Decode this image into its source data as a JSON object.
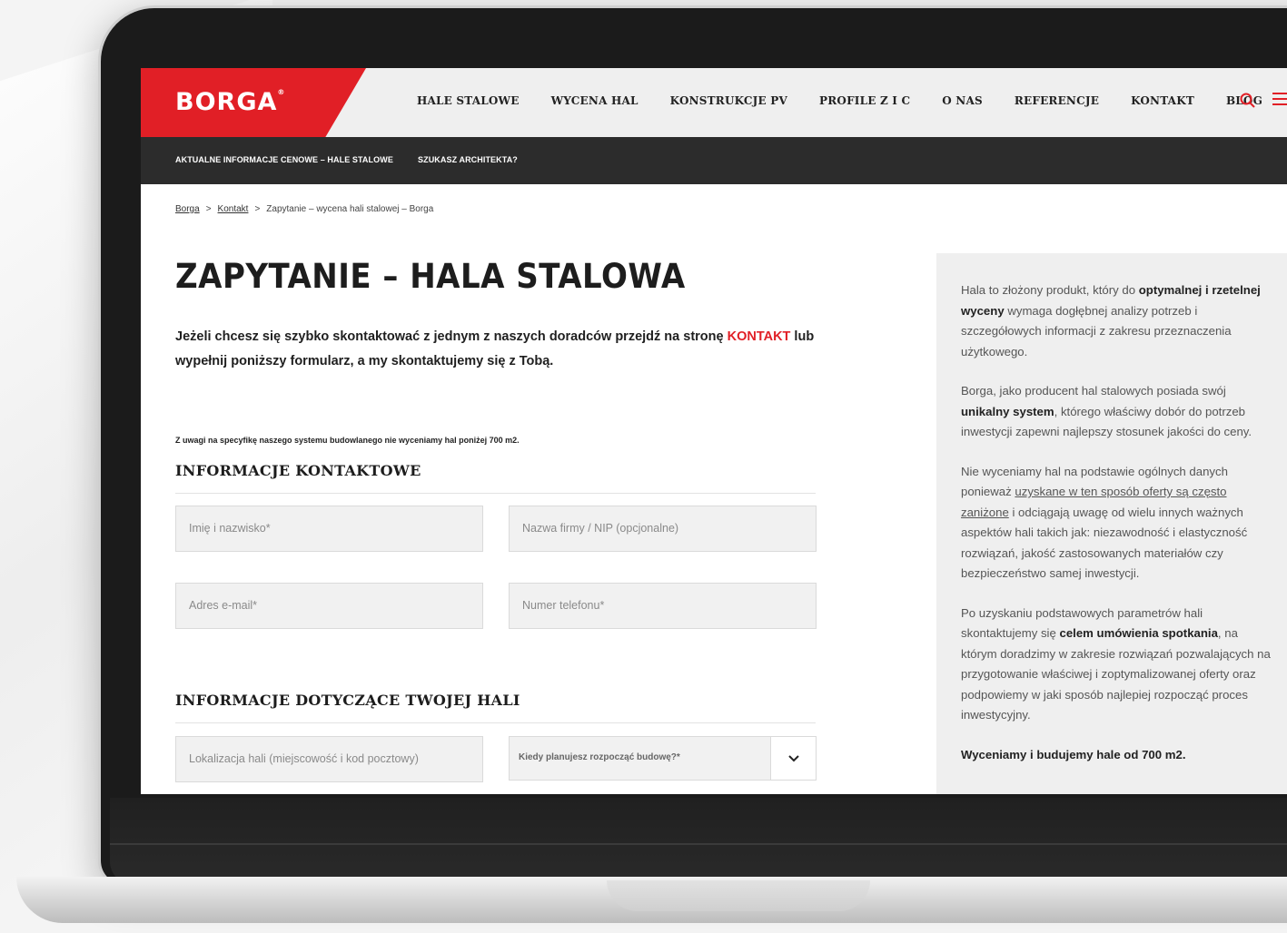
{
  "brand": {
    "logo": "BORGA",
    "registered": "®",
    "accent": "#e11f26"
  },
  "nav": {
    "items": [
      "HALE STALOWE",
      "WYCENA HAL",
      "KONSTRUKCJE PV",
      "PROFILE Z I C",
      "O NAS",
      "REFERENCJE",
      "KONTAKT",
      "BLOG"
    ]
  },
  "subnav": {
    "item1": "AKTUALNE INFORMACJE CENOWE – HALE STALOWE",
    "item2": "SZUKASZ ARCHITEKTA?"
  },
  "breadcrumb": {
    "home": "Borga",
    "sep": ">",
    "contact": "Kontakt",
    "current": "Zapytanie – wycena hali stalowej – Borga"
  },
  "page": {
    "title": "ZAPYTANIE – HALA STALOWA",
    "intro_before": "Jeżeli chcesz się szybko skontaktować z jednym z naszych doradców przejdź na stronę ",
    "intro_link": "KONTAKT",
    "intro_after": " lub wypełnij poniższy formularz, a my skontaktujemy się z Tobą.",
    "note": "Z uwagi na specyfikę naszego systemu budowlanego nie wyceniamy hal poniżej 700 m2."
  },
  "form": {
    "section_contact": "INFORMACJE KONTAKTOWE",
    "name_placeholder": "Imię i nazwisko*",
    "company_placeholder": "Nazwa firmy / NIP (opcjonalne)",
    "email_placeholder": "Adres e-mail*",
    "phone_placeholder": "Numer telefonu*",
    "section_hall": "INFORMACJE DOTYCZĄCE TWOJEJ HALI",
    "location_placeholder": "Lokalizacja hali (miejscowość i kod pocztowy)",
    "start_select": "Kiedy planujesz rozpocząć budowę?*"
  },
  "sidebar": {
    "p1_a": "Hala to złożony produkt, który do ",
    "p1_b": "optymalnej i rzetelnej wyceny",
    "p1_c": " wymaga dogłębnej analizy potrzeb i szczegółowych informacji z zakresu przeznaczenia użytkowego.",
    "p2_a": "Borga, jako producent hal stalowych posiada swój ",
    "p2_b": "unikalny system",
    "p2_c": ", którego właściwy dobór do potrzeb inwestycji zapewni najlepszy stosunek jakości do ceny.",
    "p3_a": "Nie wyceniamy hal na podstawie ogólnych danych ponieważ ",
    "p3_b": "uzyskane w ten sposób oferty są często zaniżone",
    "p3_c": " i odciągają uwagę od wielu innych ważnych aspektów hali takich jak: niezawodność i elastyczność rozwiązań, jakość zastosowanych materiałów czy bezpieczeństwo samej inwestycji.",
    "p4_a": "Po uzyskaniu podstawowych parametrów hali skontaktujemy się ",
    "p4_b": "celem umówienia spotkania",
    "p4_c": ", na którym doradzimy w zakresie rozwiązań pozwalających na przygotowanie właściwej i zoptymalizowanej oferty oraz podpowiemy w jaki sposób najlepiej rozpocząć proces inwestycyjny.",
    "p5": "Wyceniamy i budujemy hale od 700 m2."
  }
}
